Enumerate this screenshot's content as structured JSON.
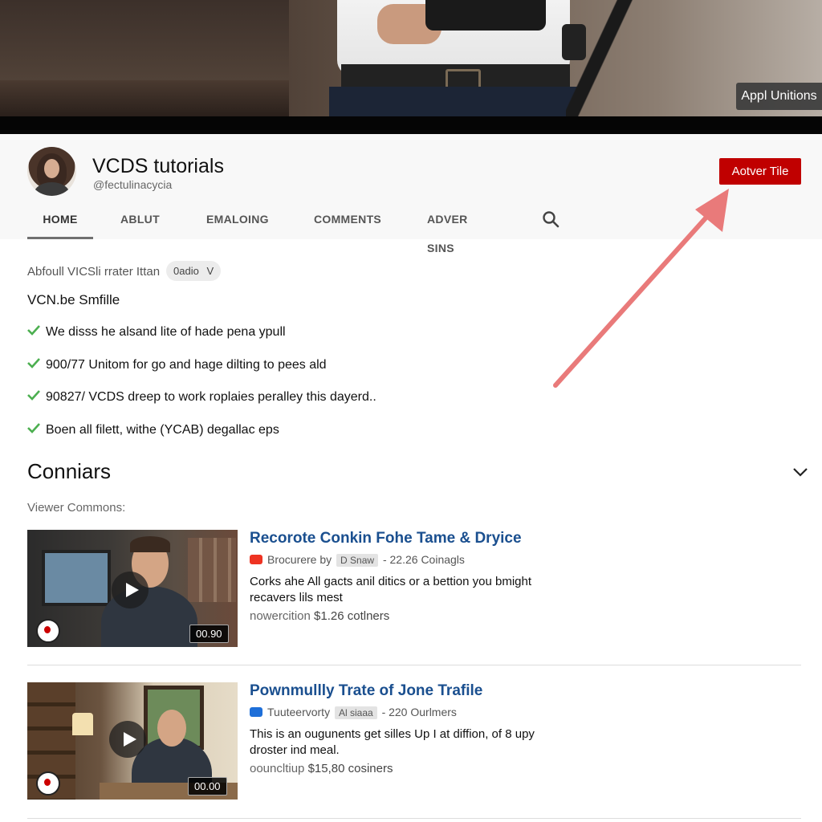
{
  "banner": {
    "button_label": "Appl Unitions"
  },
  "channel": {
    "name": "VCDS tutorials",
    "handle": "@fectulinacycia",
    "action_button": "Aotver Tile"
  },
  "tabs": [
    {
      "label": "HOME",
      "active": true
    },
    {
      "label": "ABLUT"
    },
    {
      "label": "EMALOING"
    },
    {
      "label": "COMMENTS"
    },
    {
      "label": "ADVER SINS"
    }
  ],
  "about": {
    "line": "Abfoull VICSli rrater Ittan",
    "chip": "0adio",
    "chip_caret": "V",
    "subtitle": "VCN.be Smfille",
    "checks": [
      "We disss he alsand lite of hade pena ypull",
      "900/77 Unitom for go and hage dilting to pees ald",
      "90827/ VCDS dreep to work roplaies peralley this dayerd..",
      "Boen all filett, withe (YCAB) degallac eps"
    ],
    "check_color": "#4caf50"
  },
  "comments": {
    "title": "Conniars",
    "viewer_label": "Viewer Commons:",
    "videos": [
      {
        "title": "Recorote Conkin Fohe Tame & Dryice",
        "channel": "Brocurere by",
        "tag": "D Snaw",
        "views": "- 22.26 Coinagls",
        "description": "Corks ahe All gacts anil ditics or a bettion you bmight recavers lils mest",
        "stats_label": "nowercition",
        "price": "$1.26 cotlners",
        "duration": "00.90"
      },
      {
        "title": "Pownmullly Trate of Jone Trafile",
        "channel": "Tuuteervorty",
        "tag": "Al siaaa",
        "views": "- 220 Ourlmers",
        "description": "This is an ougunents get silles Up I at diffion, of 8 upy droster ind meal.",
        "stats_label": "oouncltiup",
        "price": "$15,80 cosiners",
        "duration": "00.00"
      }
    ]
  },
  "colors": {
    "accent_red": "#c00000",
    "title_blue": "#1a4f8f",
    "arrow": "#e97a7a"
  }
}
